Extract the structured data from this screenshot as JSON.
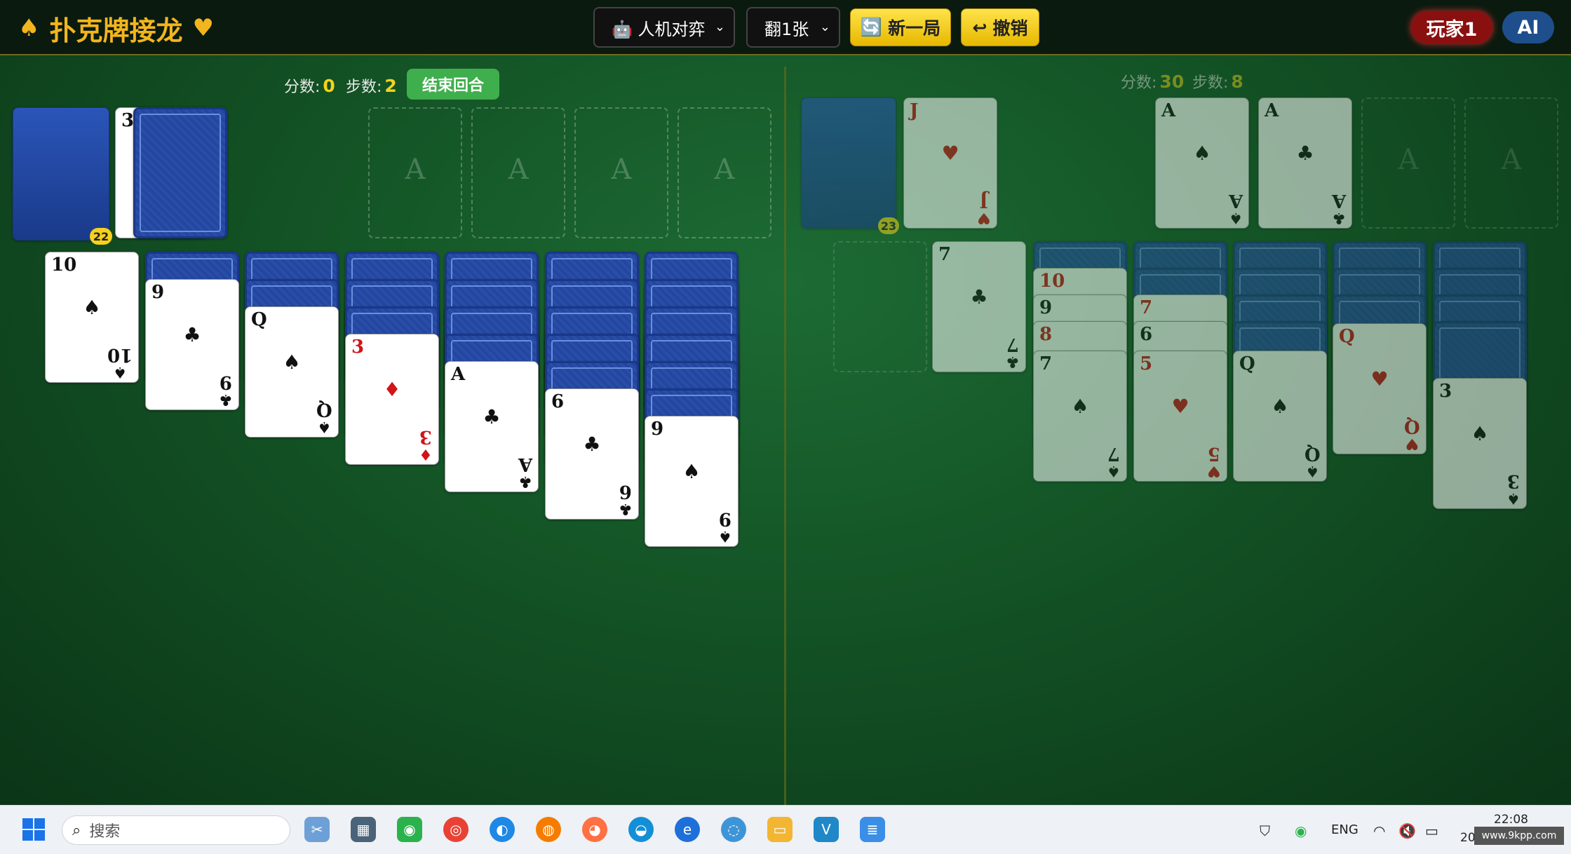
{
  "app": {
    "title": "扑克牌接龙",
    "spade": "♠",
    "heart": "♥"
  },
  "toolbar": {
    "mode": {
      "label": "🤖 人机对弈",
      "options": [
        "人机对弈"
      ]
    },
    "draw": {
      "label": "翻1张"
    },
    "new_game": "新一局",
    "new_game_icon": "🔄",
    "undo": "撤销",
    "undo_icon": "↩",
    "player": "玩家1",
    "ai": "AI"
  },
  "player": {
    "score_label": "分数:",
    "score": "0",
    "steps_label": "步数:",
    "steps": "2",
    "end_turn": "结束回合",
    "stock_count": "22",
    "waste_top": "3",
    "foundation_label": "A",
    "tableau": [
      {
        "rank": "10",
        "suit": "♠",
        "color": "blk"
      },
      {
        "rank": "9",
        "suit": "♣",
        "color": "blk"
      },
      {
        "rank": "Q",
        "suit": "♠",
        "color": "blk"
      },
      {
        "rank": "3",
        "suit": "♦",
        "color": "red"
      },
      {
        "rank": "A",
        "suit": "♣",
        "color": "blk"
      },
      {
        "rank": "6",
        "suit": "♣",
        "color": "blk"
      },
      {
        "rank": "9",
        "suit": "♠",
        "color": "blk"
      }
    ]
  },
  "ai": {
    "score_label": "分数:",
    "score": "30",
    "steps_label": "步数:",
    "steps": "8",
    "stock_count": "23",
    "waste": {
      "rank": "J",
      "suit": "♥",
      "color": "red"
    },
    "foundations": [
      {
        "rank": "A",
        "suit": "♠",
        "color": "blk"
      },
      {
        "rank": "A",
        "suit": "♣",
        "color": "blk"
      }
    ],
    "foundation_label": "A",
    "col2": {
      "rank": "7",
      "suit": "♣",
      "color": "blk"
    },
    "col3": [
      {
        "rank": "10",
        "color": "red"
      },
      {
        "rank": "9",
        "color": "blk"
      },
      {
        "rank": "8",
        "color": "red"
      },
      {
        "rank": "7",
        "suit": "♠",
        "color": "blk"
      }
    ],
    "col4": [
      {
        "rank": "7",
        "color": "red"
      },
      {
        "rank": "6",
        "color": "blk"
      },
      {
        "rank": "5",
        "suit": "♥",
        "color": "red"
      }
    ],
    "col5": {
      "rank": "Q",
      "suit": "♠",
      "color": "blk"
    },
    "col6": {
      "rank": "Q",
      "suit": "♥",
      "color": "red"
    },
    "col7": {
      "rank": "3",
      "suit": "♠",
      "color": "blk"
    }
  },
  "taskbar": {
    "search_placeholder": "搜索",
    "lang": "ENG",
    "time": "22:08",
    "date": "202",
    "watermark": "www.9kpp.com"
  }
}
